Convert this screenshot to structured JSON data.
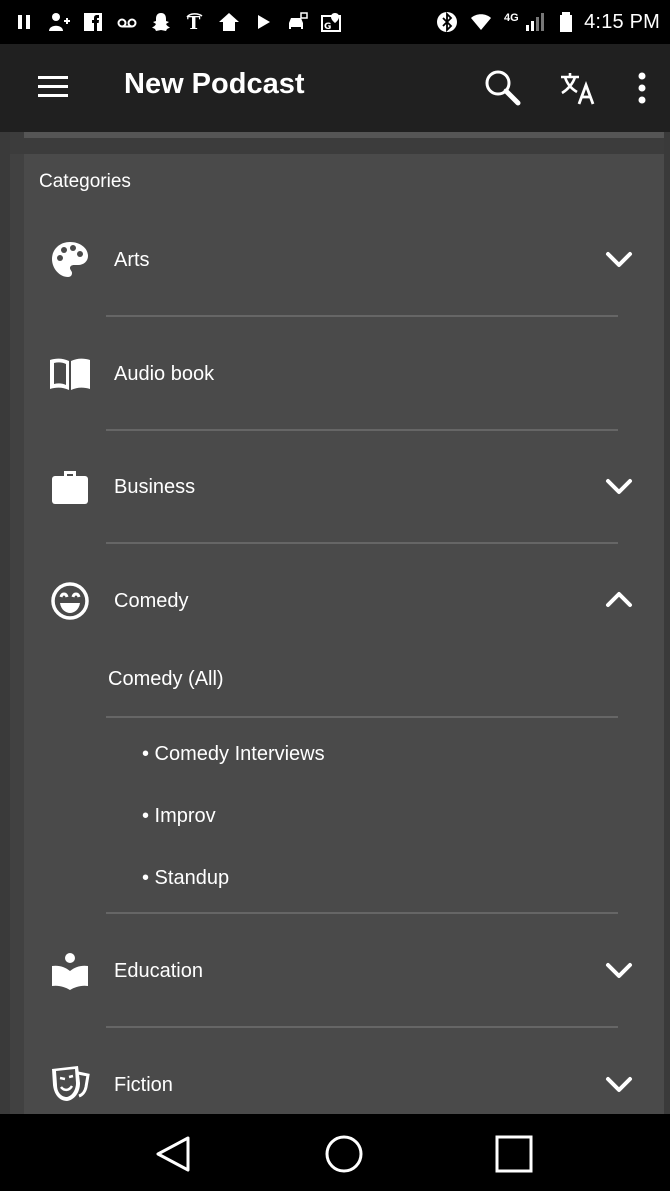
{
  "status_bar": {
    "time": "4:15 PM",
    "network": "4G",
    "icons": [
      "pause-icon",
      "add-person-icon",
      "facebook-icon",
      "voicemail-icon",
      "snapchat-icon",
      "nyt-icon",
      "home-icon",
      "play-icon",
      "car-icon",
      "maps-icon",
      "bluetooth-icon",
      "wifi-icon",
      "signal-icon",
      "battery-icon"
    ]
  },
  "app_bar": {
    "title": "New Podcast",
    "icons": [
      "menu-icon",
      "search-icon",
      "translate-icon",
      "more-vert-icon"
    ]
  },
  "categories": {
    "heading": "Categories",
    "items": [
      {
        "label": "Arts",
        "icon": "palette-icon",
        "expandable": true,
        "expanded": false
      },
      {
        "label": "Audio book",
        "icon": "book-icon",
        "expandable": false
      },
      {
        "label": "Business",
        "icon": "briefcase-icon",
        "expandable": true,
        "expanded": false
      },
      {
        "label": "Comedy",
        "icon": "smiley-icon",
        "expandable": true,
        "expanded": true,
        "all_label": "Comedy (All)",
        "subcategories": [
          "• Comedy Interviews",
          "• Improv",
          "• Standup"
        ]
      },
      {
        "label": "Education",
        "icon": "reading-person-icon",
        "expandable": true,
        "expanded": false
      },
      {
        "label": "Fiction",
        "icon": "theater-mask-icon",
        "expandable": true,
        "expanded": false
      }
    ]
  },
  "nav_bar": {
    "icons": [
      "back-icon",
      "home-circle-icon",
      "recents-icon"
    ]
  },
  "colors": {
    "status_bar_bg": "#000000",
    "app_bar_bg": "#202020",
    "panel_bg": "#4a4a4a",
    "divider": "#666666",
    "text": "#ffffff"
  }
}
